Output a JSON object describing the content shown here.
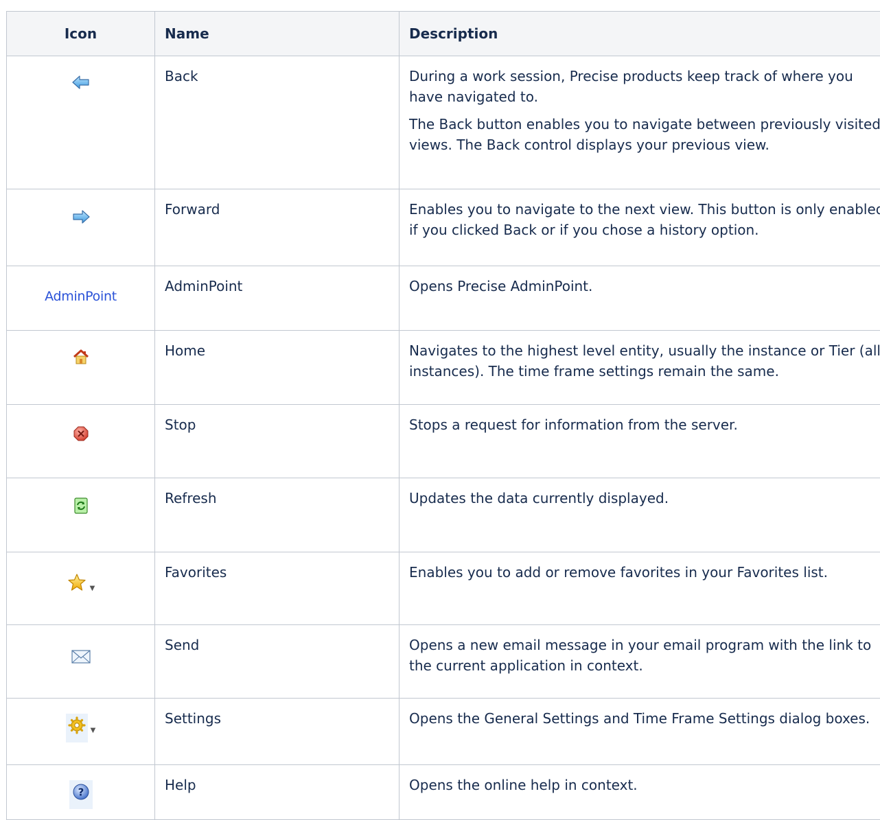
{
  "headers": {
    "icon": "Icon",
    "name": "Name",
    "description": "Description"
  },
  "rows": [
    {
      "icon": "back-arrow-icon",
      "name": "Back",
      "desc": [
        "During a work session, Precise products keep track of where you have navigated to.",
        "The Back button enables you to navigate between previously visited views. The Back control displays your previous view."
      ]
    },
    {
      "icon": "forward-arrow-icon",
      "name": "Forward",
      "desc": [
        "Enables you to navigate to the next view. This button is only enabled if you clicked Back or if you chose a history option."
      ]
    },
    {
      "icon": "adminpoint-text-icon",
      "icon_text": "AdminPoint",
      "name": "AdminPoint",
      "desc": [
        "Opens Precise AdminPoint."
      ]
    },
    {
      "icon": "home-icon",
      "name": "Home",
      "desc": [
        "Navigates to the highest level entity, usually the instance or Tier (all instances). The time frame settings remain the same."
      ]
    },
    {
      "icon": "stop-icon",
      "name": "Stop",
      "desc": [
        "Stops a request for information from the server."
      ]
    },
    {
      "icon": "refresh-icon",
      "name": "Refresh",
      "desc": [
        "Updates the data currently displayed."
      ]
    },
    {
      "icon": "star-icon",
      "name": "Favorites",
      "desc": [
        "Enables you to add or remove favorites in your Favorites list."
      ]
    },
    {
      "icon": "envelope-icon",
      "name": "Send",
      "desc": [
        "Opens a new email message in your email program with the link to the current application in context."
      ]
    },
    {
      "icon": "gear-icon",
      "name": "Settings",
      "desc": [
        "Opens the General Settings and Time Frame Settings dialog boxes."
      ]
    },
    {
      "icon": "help-icon",
      "name": "Help",
      "desc": [
        "Opens the online help in context."
      ]
    }
  ],
  "colors": {
    "border": "#c1c7d0",
    "header_bg": "#f4f5f7",
    "text": "#172b4d"
  }
}
